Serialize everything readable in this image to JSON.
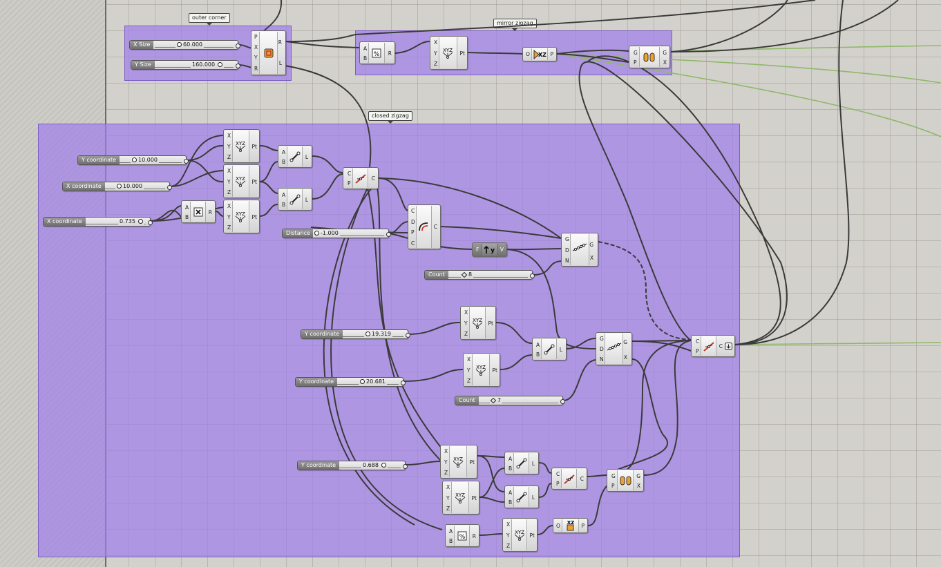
{
  "groups": {
    "outer_corner": "outer corner",
    "mirror_zigzag": "mirror zigzag",
    "closed_zigzag": "closed zigzag"
  },
  "sliders": {
    "x_size": {
      "label": "X Size",
      "value": "60.000"
    },
    "y_size": {
      "label": "Y Size",
      "value": "160.000"
    },
    "y_coord_1": {
      "label": "Y coordinate",
      "value": "10.000"
    },
    "x_coord_1": {
      "label": "X coordinate",
      "value": "10.000"
    },
    "x_coord_2": {
      "label": "X coordinate",
      "value": "0.735"
    },
    "distance": {
      "label": "Distance",
      "value": "-1.000"
    },
    "count_1": {
      "label": "Count",
      "value": "8"
    },
    "y_coord_2": {
      "label": "Y coordinate",
      "value": "19.319"
    },
    "y_coord_3": {
      "label": "Y coordinate",
      "value": "20.681"
    },
    "count_2": {
      "label": "Count",
      "value": "7"
    },
    "y_coord_4": {
      "label": "Y coordinate",
      "value": "0.688"
    }
  },
  "ports": {
    "P": "P",
    "X": "X",
    "Y": "Y",
    "Z": "Z",
    "R": "R",
    "L": "L",
    "A": "A",
    "B": "B",
    "Pt": "Pt",
    "C": "C",
    "D": "D",
    "G": "G",
    "N": "N",
    "F": "F",
    "V": "V",
    "O": "O"
  },
  "colors": {
    "group_fill": "#a07deb",
    "wire": "#3a3a3a",
    "wire_green": "#8fb86a",
    "canvas": "#d3d1cb"
  },
  "icons": {
    "rectangle": "rectangle-icon",
    "division": "division-icon",
    "construct_point": "construct-point-icon",
    "mirror": "mirror-icon",
    "join": "join-curves-icon",
    "multiplication": "multiplication-icon",
    "line": "line-icon",
    "polyline": "polyline-icon",
    "offset": "offset-curve-icon",
    "evaluate": "evaluate-icon",
    "divide_curve": "divide-curve-icon",
    "xz_plane": "xz-plane-icon"
  }
}
